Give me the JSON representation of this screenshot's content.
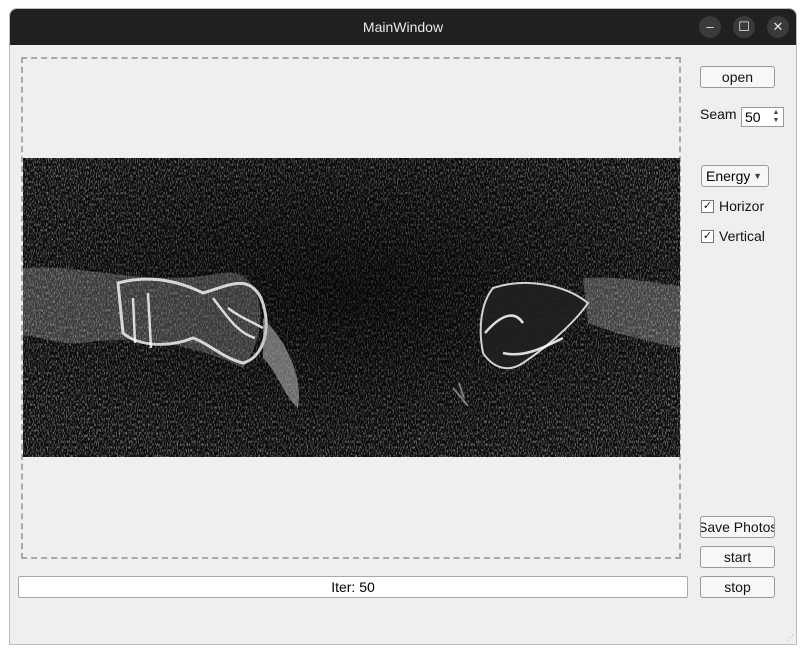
{
  "window": {
    "title": "MainWindow",
    "minimize_icon": "minimize-icon",
    "maximize_icon": "maximize-icon",
    "close_icon": "close-icon",
    "minimize_glyph": "–",
    "maximize_glyph": "☐",
    "close_glyph": "✕"
  },
  "controls": {
    "open_label": "open",
    "seam_label": "Seam",
    "seam_value": "50",
    "energy_selected": "Energy",
    "horizontal_label": "Horizor",
    "horizontal_checked": true,
    "vertical_label": "Vertical",
    "vertical_checked": true,
    "save_label": "Save Photos",
    "start_label": "start",
    "stop_label": "stop",
    "check_glyph": "✓"
  },
  "progress": {
    "text": "Iter: 50",
    "fraction": 0
  },
  "image": {
    "description_icon": "energy-map-image"
  }
}
